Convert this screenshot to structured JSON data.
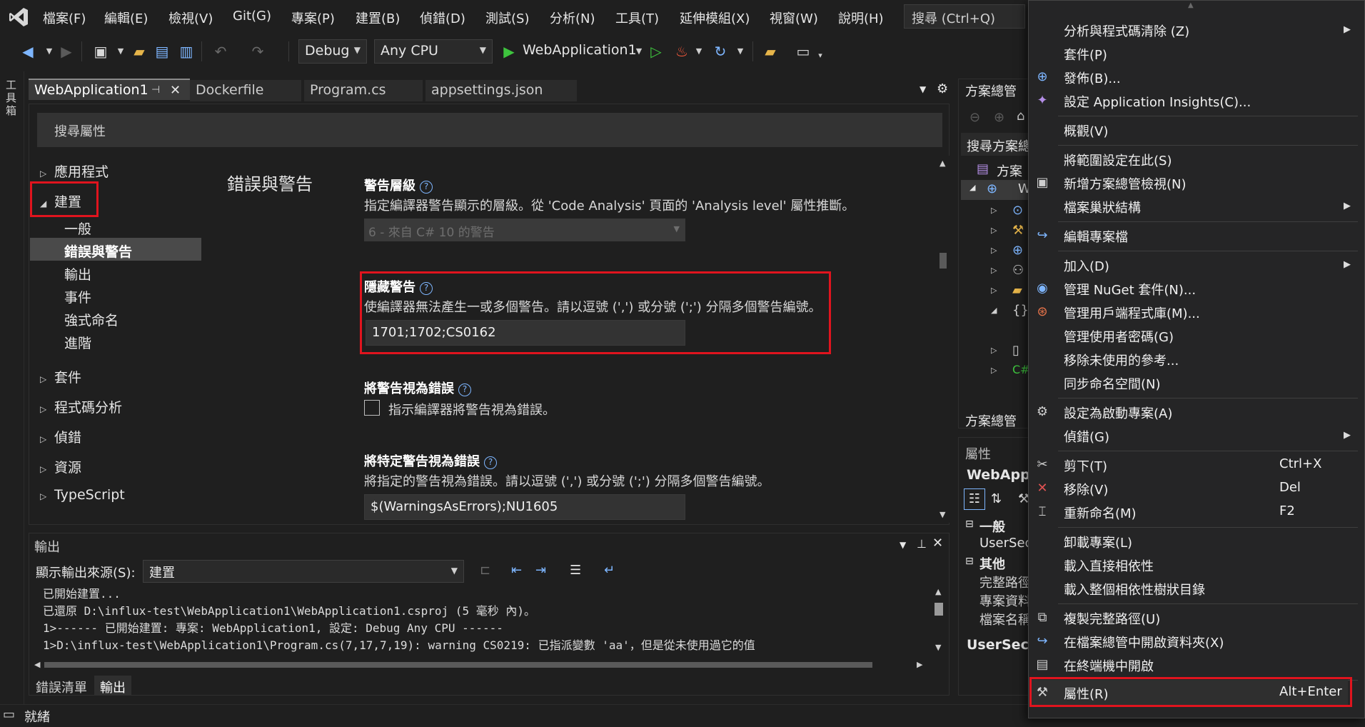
{
  "menubar": {
    "items": [
      "檔案(F)",
      "編輯(E)",
      "檢視(V)",
      "Git(G)",
      "專案(P)",
      "建置(B)",
      "偵錯(D)",
      "測試(S)",
      "分析(N)",
      "工具(T)",
      "延伸模組(X)",
      "視窗(W)",
      "說明(H)"
    ],
    "search_placeholder": "搜尋 (Ctrl+Q)"
  },
  "toolbar": {
    "config": "Debug",
    "platform": "Any CPU",
    "run_target": "WebApplication1"
  },
  "toolbox_label": "工具箱",
  "doc_tabs": [
    {
      "label": "WebApplication1",
      "active": true
    },
    {
      "label": "Dockerfile",
      "active": false
    },
    {
      "label": "Program.cs",
      "active": false
    },
    {
      "label": "appsettings.json",
      "active": false
    }
  ],
  "property_page": {
    "search_placeholder": "搜尋屬性",
    "nav": {
      "application": "應用程式",
      "build": "建置",
      "build_children": [
        "一般",
        "錯誤與警告",
        "輸出",
        "事件",
        "強式命名",
        "進階"
      ],
      "package": "套件",
      "code_analysis": "程式碼分析",
      "debug": "偵錯",
      "resources": "資源",
      "typescript": "TypeScript"
    },
    "section_title": "錯誤與警告",
    "warning_level": {
      "title": "警告層級",
      "desc": "指定編譯器警告顯示的層級。從 'Code Analysis' 頁面的 'Analysis level' 屬性推斷。",
      "value": "6 - 來自 C# 10 的警告"
    },
    "suppress": {
      "title": "隱藏警告",
      "desc": "使編譯器無法產生一或多個警告。請以逗號 (',') 或分號 (';') 分隔多個警告編號。",
      "value": "1701;1702;CS0162"
    },
    "treat_as_errors": {
      "title": "將警告視為錯誤",
      "checkbox_label": "指示編譯器將警告視為錯誤。"
    },
    "specific_as_errors": {
      "title": "將特定警告視為錯誤",
      "desc": "將指定的警告視為錯誤。請以逗號 (',') 或分號 (';') 分隔多個警告編號。",
      "value": "$(WarningsAsErrors);NU1605"
    }
  },
  "output": {
    "title": "輸出",
    "source_label": "顯示輸出來源(S):",
    "source_value": "建置",
    "lines": [
      "已開始建置...",
      "已還原 D:\\influx-test\\WebApplication1\\WebApplication1.csproj (5 毫秒 內)。",
      "1>------ 已開始建置: 專案: WebApplication1, 設定: Debug Any CPU ------",
      "1>D:\\influx-test\\WebApplication1\\Program.cs(7,17,7,19): warning CS0219: 已指派變數 'aa'，但是從未使用過它的值"
    ],
    "tabs": [
      "錯誤清單",
      "輸出"
    ]
  },
  "solution_explorer": {
    "title": "方案總管",
    "search": "搜尋方案總",
    "root": "方案",
    "project": "W",
    "bottom_tab": "方案總管"
  },
  "properties_pane": {
    "title": "屬性",
    "object": "WebAppl",
    "cat_general": "一般",
    "row_usersecrets": "UserSec",
    "cat_other": "其他",
    "row_fullpath": "完整路徑",
    "row_projdata": "專案資料",
    "row_filename": "檔案名稱",
    "desc_title": "UserSecre"
  },
  "status": {
    "text": "就緒"
  },
  "context_menu": {
    "items": [
      {
        "label": "分析與程式碼清除 (Z)",
        "submenu": true
      },
      {
        "label": "套件(P)"
      },
      {
        "label": "發佈(B)..."
      },
      {
        "label": "設定 Application Insights(C)..."
      },
      {
        "label": "概觀(V)"
      },
      {
        "label": "將範圍設定在此(S)"
      },
      {
        "label": "新增方案總管檢視(N)"
      },
      {
        "label": "檔案巢狀結構",
        "submenu": true
      },
      {
        "label": "編輯專案檔"
      },
      {
        "label": "加入(D)",
        "submenu": true
      },
      {
        "label": "管理 NuGet 套件(N)..."
      },
      {
        "label": "管理用戶端程式庫(M)..."
      },
      {
        "label": "管理使用者密碼(G)"
      },
      {
        "label": "移除未使用的參考..."
      },
      {
        "label": "同步命名空間(N)"
      },
      {
        "label": "設定為啟動專案(A)"
      },
      {
        "label": "偵錯(G)",
        "submenu": true
      },
      {
        "label": "剪下(T)",
        "shortcut": "Ctrl+X"
      },
      {
        "label": "移除(V)",
        "shortcut": "Del"
      },
      {
        "label": "重新命名(M)",
        "shortcut": "F2"
      },
      {
        "label": "卸載專案(L)"
      },
      {
        "label": "載入直接相依性"
      },
      {
        "label": "載入整個相依性樹狀目錄"
      },
      {
        "label": "複製完整路徑(U)"
      },
      {
        "label": "在檔案總管中開啟資料夾(X)"
      },
      {
        "label": "在終端機中開啟"
      },
      {
        "label": "屬性(R)",
        "shortcut": "Alt+Enter"
      }
    ]
  },
  "colors": {
    "highlight_box": "#e0141e",
    "accent_blue": "#7eb6ff",
    "run_green": "#3ec43e"
  }
}
